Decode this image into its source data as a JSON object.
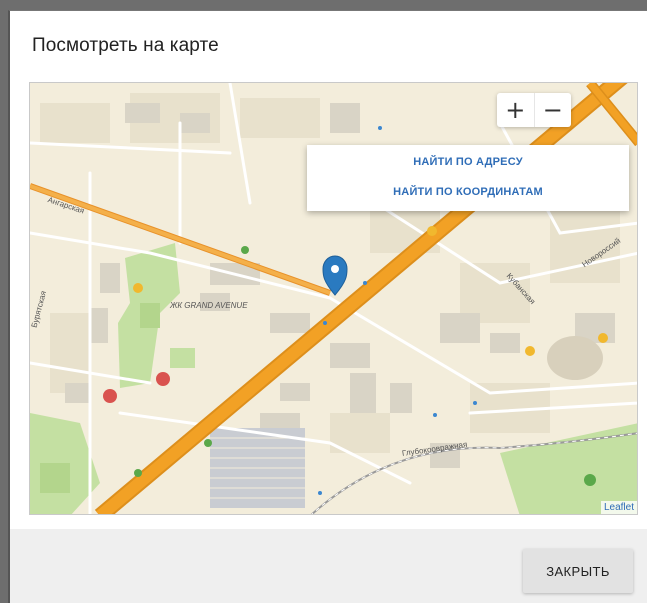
{
  "dialog": {
    "title": "Посмотреть на карте",
    "close_label": "ЗАКРЫТЬ"
  },
  "map": {
    "zoom_in_label": "+",
    "zoom_out_label": "−",
    "search_by_address": "НАЙТИ ПО АДРЕСУ",
    "search_by_coordinates": "НАЙТИ ПО КООРДИНАТАМ",
    "attribution": "Leaflet",
    "labels": {
      "angarskaya": "Ангарская",
      "buryatskaya": "Бурятская",
      "kubanskaya": "Кубанская",
      "novorossiyskaya": "Новороссий",
      "grand_avenue": "ЖК GRAND AVENUE",
      "glubokoovrazhnaya": "Глубокоовражная"
    },
    "marker_color": "#2a7ac0",
    "main_road_color": "#f0a020"
  }
}
